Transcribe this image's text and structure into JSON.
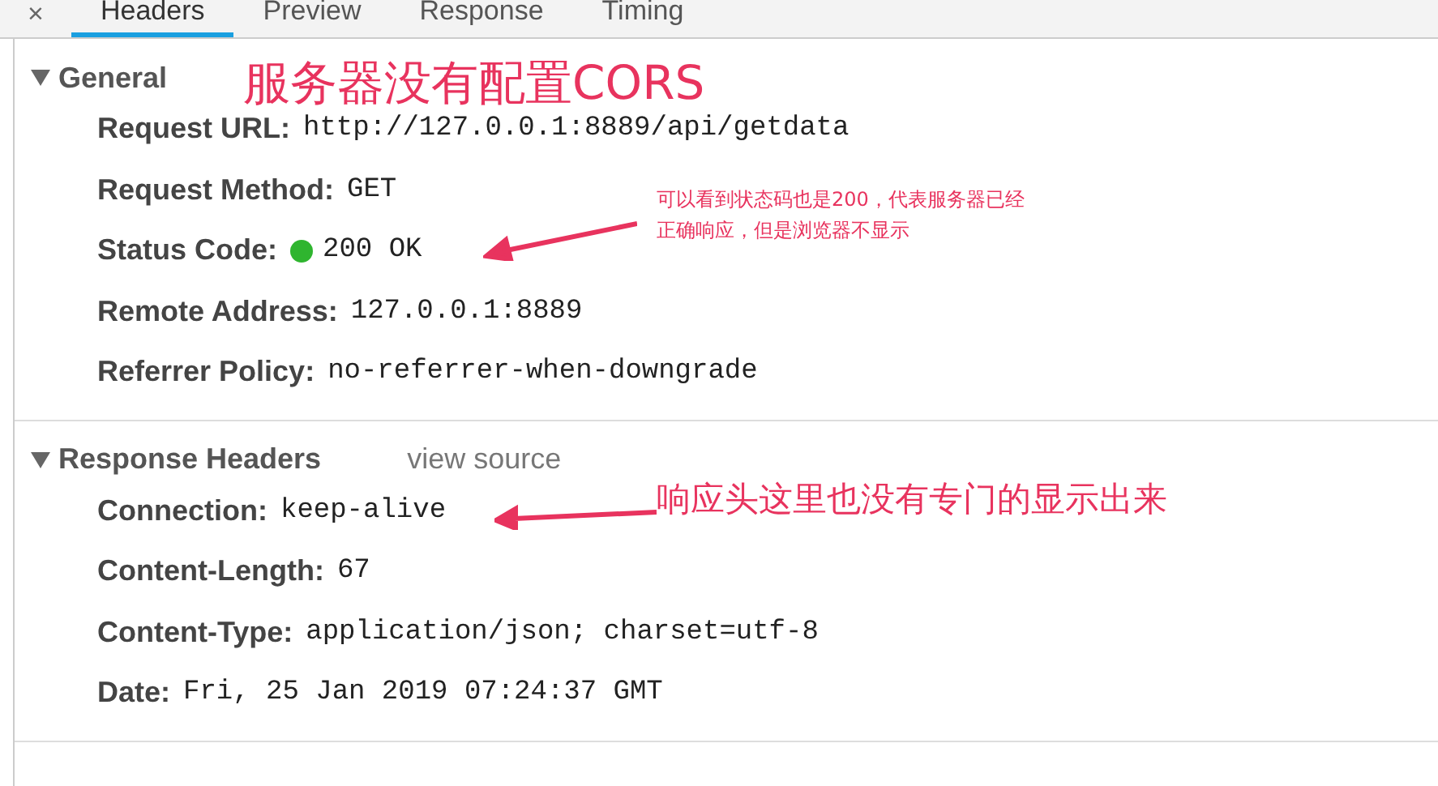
{
  "tabs": [
    {
      "label": "Headers",
      "selected": true
    },
    {
      "label": "Preview",
      "selected": false
    },
    {
      "label": "Response",
      "selected": false
    },
    {
      "label": "Timing",
      "selected": false
    }
  ],
  "close_icon": "×",
  "sections": [
    {
      "title": "General",
      "expanded": true,
      "rows": [
        {
          "name": "Request URL:",
          "value": "http://127.0.0.1:8889/api/getdata"
        },
        {
          "name": "Request Method:",
          "value": "GET"
        },
        {
          "name": "Status Code:",
          "value": "200 OK",
          "color": "#2fb52f"
        },
        {
          "name": "Remote Address:",
          "value": "127.0.0.1:8889"
        },
        {
          "name": "Referrer Policy:",
          "value": "no-referrer-when-downgrade"
        }
      ]
    },
    {
      "title": "Response Headers",
      "link": "view source",
      "expanded": true,
      "rows": [
        {
          "name": "Connection:",
          "value": "keep-alive"
        },
        {
          "name": "Content-Length:",
          "value": "67"
        },
        {
          "name": "Content-Type:",
          "value": "application/json; charset=utf-8"
        },
        {
          "name": "Date:",
          "value": "Fri, 25 Jan 2019 07:24:37 GMT"
        }
      ]
    }
  ],
  "annotations": [
    {
      "kind": "title",
      "text": "服务器没有配置CORS"
    },
    {
      "kind": "note",
      "text": "可以看到状态码也是200，代表服务器已经正确响应，但是浏览器不显示"
    },
    {
      "kind": "callout",
      "text": "响应头这里也没有专门的显示出来"
    }
  ]
}
